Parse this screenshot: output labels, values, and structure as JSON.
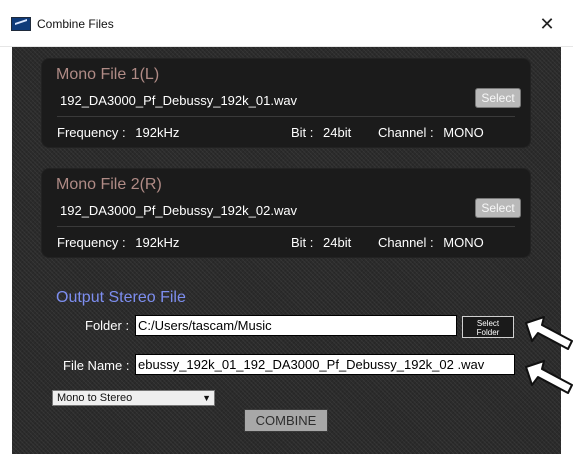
{
  "window": {
    "title": "Combine Files",
    "close_glyph": "✕",
    "icon": "app-icon"
  },
  "file1": {
    "heading": "Mono File 1(L)",
    "filename": "192_DA3000_Pf_Debussy_192k_01.wav",
    "select_label": "Select",
    "frequency_label": "Frequency :",
    "frequency_value": "192kHz",
    "bit_label": "Bit :",
    "bit_value": "24bit",
    "channel_label": "Channel :",
    "channel_value": "MONO"
  },
  "file2": {
    "heading": "Mono File 2(R)",
    "filename": "192_DA3000_Pf_Debussy_192k_02.wav",
    "select_label": "Select",
    "frequency_label": "Frequency :",
    "frequency_value": "192kHz",
    "bit_label": "Bit :",
    "bit_value": "24bit",
    "channel_label": "Channel :",
    "channel_value": "MONO"
  },
  "output": {
    "heading": "Output Stereo File",
    "folder_label": "Folder :",
    "folder_value": "C:/Users/tascam/Music",
    "select_folder_line1": "Select",
    "select_folder_line2": "Folder",
    "filename_label": "File Name :",
    "filename_value": "ebussy_192k_01_192_DA3000_Pf_Debussy_192k_02 .wav",
    "mode_value": "Mono to Stereo",
    "mode_arrow": "▼",
    "combine_label": "COMBINE"
  },
  "colors": {
    "panel_bg": "#2b2b2b",
    "card_bg": "#1b1b1b",
    "mono_heading": "#b08b86",
    "output_heading": "#7d8ef0"
  },
  "annotations": {
    "arrow_icons": [
      "arrow-pointer-icon",
      "arrow-pointer-icon"
    ]
  }
}
